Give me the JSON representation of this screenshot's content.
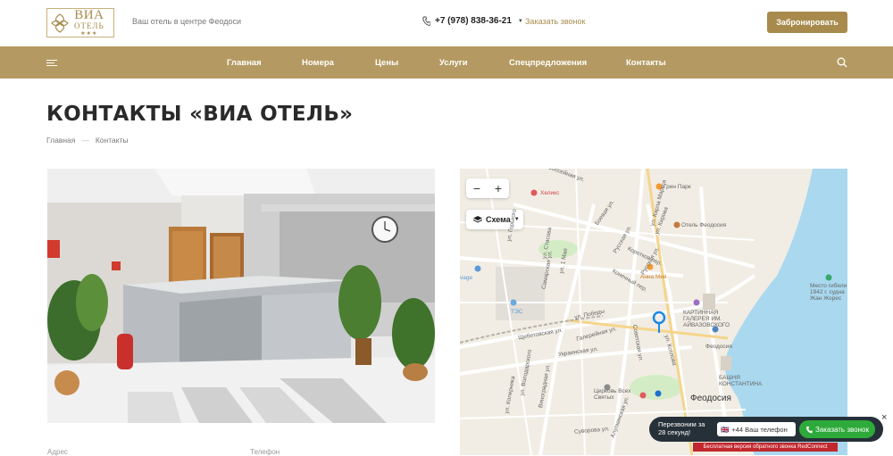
{
  "header": {
    "logo": {
      "name": "ВИА",
      "sub": "ОТЕЛЬ",
      "stars": "★★★"
    },
    "tagline": "Ваш отель в центре Феодоси",
    "phone": "+7 (978) 838-36-21",
    "callback_link": "Заказать звонок",
    "book_button": "Забронировать"
  },
  "nav": {
    "items": [
      {
        "label": "Главная"
      },
      {
        "label": "Номера"
      },
      {
        "label": "Цены"
      },
      {
        "label": "Услуги"
      },
      {
        "label": "Спецпредложения"
      },
      {
        "label": "Контакты"
      }
    ]
  },
  "main": {
    "title": "КОНТАКТЫ «ВИА ОТЕЛЬ»",
    "breadcrumb": [
      "Главная",
      "—",
      "Контакты"
    ],
    "bottom_labels": {
      "address": "Адрес",
      "phone": "Телефон"
    }
  },
  "map": {
    "zoom_in": "+",
    "zoom_out": "−",
    "scheme": "Схема",
    "labels": {
      "grin_park": "Грин Парк",
      "helix": "Хеликс",
      "hotel": "Отель Феодосия",
      "anna": "Анна Мия",
      "gallery": "КАРТИННАЯ ГАЛЕРЕЯ ИМ. АЙВАЗОВСКОГО",
      "place": "Место гибели 1942 г. судна Жан Жорес",
      "feodosia_small": "Феодосия",
      "bashnya": "БАШНЯ КОНСТАНТИНА",
      "church": "Церковь Всех Святых",
      "feodosia": "Феодосия",
      "tes": "ТЭС",
      "savage": "vage",
      "st_pobedy": "ул. Победы",
      "st_ukr": "Украинская ул.",
      "st_shcheb": "Щебетовская ул.",
      "st_galer": "Галерейная ул.",
      "st_sovet": "Советская ул.",
      "st_russk": "Русская ул.",
      "st_boev": "Боевая ул.",
      "st_shosk": "Шоссейная ул.",
      "st_kotl": "ул. Котлова",
      "st_suvor": "Суворова ул.",
      "st_kor": "Коротков пер.",
      "st_karla": "ул. Карла Маркса",
      "st_kim": "ул. Кирова",
      "st_gorky": "ул. Горького",
      "st_vinogr": "Виноградная ул.",
      "st_volod": "ул. Володарского",
      "st_kopernik": "ул. Коперника",
      "st_samarsk": "Самарская ул.",
      "st_1maya": "ул. 1 Мая",
      "st_stasova": "ул. Стасова",
      "st_konechn": "Конечный пер.",
      "st_rusk": "Русская ул.",
      "st_alups": "Алупкинская ул."
    },
    "colors": {
      "water": "#a9d8ef",
      "road": "#ffffff",
      "park": "#d4ecc6",
      "marker": "#1e88e5"
    }
  },
  "callback_widget": {
    "text": "Перезвоним за 28 секунд!",
    "flag": "🇬🇧",
    "phone_placeholder": "+44 Ваш телефон",
    "button": "Заказать звонок",
    "close": "×",
    "promo": "Бесплатная версия обратного звонка RedConnect"
  }
}
